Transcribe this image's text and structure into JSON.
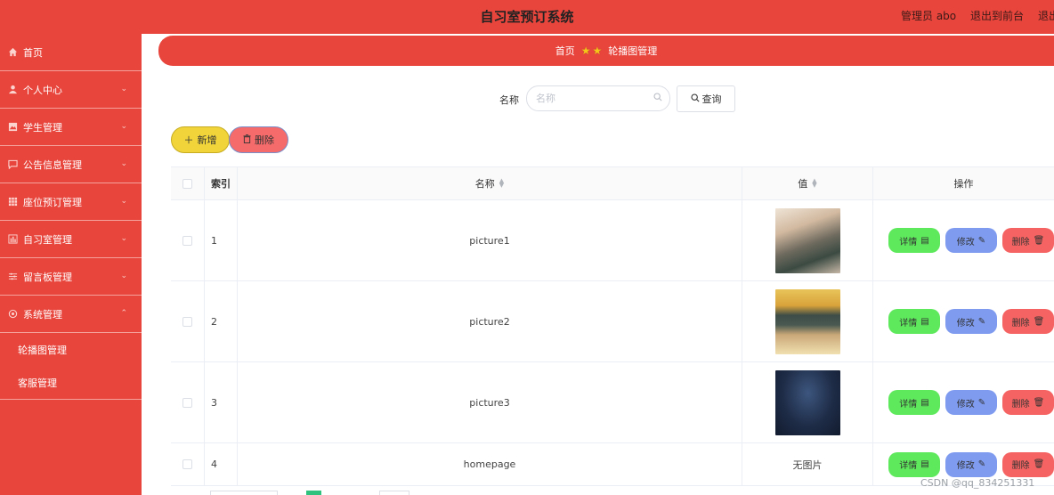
{
  "header": {
    "title": "自习室预订系统",
    "admin": "管理员 abo",
    "to_front": "退出到前台",
    "logout": "退出"
  },
  "sidebar": {
    "items": [
      {
        "label": "首页",
        "icon": "home-icon"
      },
      {
        "label": "个人中心",
        "icon": "user-icon"
      },
      {
        "label": "学生管理",
        "icon": "picture-icon"
      },
      {
        "label": "公告信息管理",
        "icon": "message-icon"
      },
      {
        "label": "座位预订管理",
        "icon": "grid-icon"
      },
      {
        "label": "自习室管理",
        "icon": "chart-icon"
      },
      {
        "label": "留言板管理",
        "icon": "sliders-icon"
      },
      {
        "label": "系统管理",
        "icon": "gear-icon"
      }
    ],
    "sub_items": [
      "轮播图管理",
      "客服管理"
    ]
  },
  "breadcrumb": {
    "home": "首页",
    "current": "轮播图管理"
  },
  "search": {
    "label": "名称",
    "placeholder": "名称",
    "button": "查询"
  },
  "toolbar": {
    "add": "新增",
    "delete": "删除"
  },
  "table": {
    "headers": {
      "index": "索引",
      "name": "名称",
      "value": "值",
      "ops": "操作"
    },
    "rows": [
      {
        "index": "1",
        "name": "picture1",
        "value_type": "image"
      },
      {
        "index": "2",
        "name": "picture2",
        "value_type": "image"
      },
      {
        "index": "3",
        "name": "picture3",
        "value_type": "image"
      },
      {
        "index": "4",
        "name": "homepage",
        "value_text": "无图片"
      }
    ],
    "ops": {
      "detail": "详情",
      "edit": "修改",
      "delete": "删除"
    }
  },
  "watermark": "CSDN @qq_834251331",
  "colors": {
    "primary": "#e8453c",
    "add": "#f0d43a",
    "detail": "#5ee85c",
    "edit": "#7e9bf0",
    "delete": "#f56462"
  }
}
